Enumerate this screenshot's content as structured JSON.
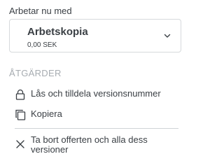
{
  "current_version": {
    "heading": "Arbetar nu med",
    "name": "Arbetskopia",
    "amount": "0,00 SEK"
  },
  "actions": {
    "heading": "ÅTGÄRDER",
    "items": [
      {
        "label": "Lås och tilldela versionsnummer",
        "icon": "lock-icon"
      },
      {
        "label": "Kopiera",
        "icon": "copy-icon"
      },
      {
        "label": "Ta bort offerten och alla dess versioner",
        "icon": "close-icon"
      }
    ]
  },
  "colors": {
    "text": "#3a3f44",
    "muted": "#a7acb1",
    "border": "#d6d9dc"
  }
}
